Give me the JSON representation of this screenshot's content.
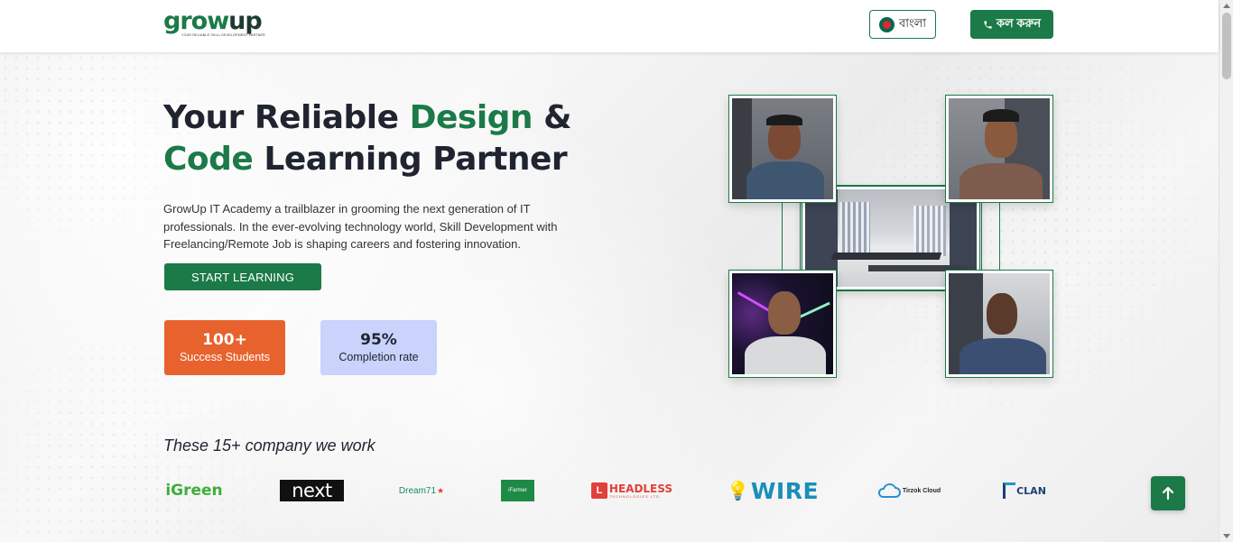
{
  "header": {
    "logo_grow": "grow",
    "logo_up": "up",
    "logo_tagline": "YOUR RELIABLE SKILL DEVELOPMENT PARTNER",
    "language_label": "বাংলা",
    "call_label": "কল করুন",
    "call_icon": "phone-icon",
    "flag_icon": "bangladesh-flag-icon"
  },
  "hero": {
    "title_part1": "Your Reliable ",
    "title_hl1": "Design",
    "title_part2": " &",
    "title_hl2": "Code",
    "title_part3": " Learning Partner",
    "description": "GrowUp IT Academy a trailblazer in grooming the next generation of IT professionals. In the ever-evolving technology world, Skill Development with Freelancing/Remote Job is shaping careers and fostering innovation.",
    "cta_label": "START LEARNING"
  },
  "stats": [
    {
      "value": "100+",
      "label": "Success Students"
    },
    {
      "value": "95%",
      "label": "Completion rate"
    }
  ],
  "companies": {
    "title": "These 15+ company we work",
    "logos": [
      {
        "name": "Green",
        "text": "iGreen"
      },
      {
        "name": "next",
        "text": "next"
      },
      {
        "name": "Dream71",
        "text": "Dream71"
      },
      {
        "name": "iFarmer",
        "text": "iFarmer"
      },
      {
        "name": "Headless",
        "text": "HEADLESS",
        "sub": "TECHNOLOGIES LTD"
      },
      {
        "name": "Wire",
        "text": "WIRE"
      },
      {
        "name": "Tirzok Cloud",
        "text": "Tirzok Cloud"
      },
      {
        "name": "Clan",
        "text": "CLAN"
      }
    ]
  },
  "colors": {
    "brand_green": "#1b7a47",
    "orange": "#e8622e",
    "lavender": "#c9d3fb"
  },
  "icons": {
    "scroll_top": "arrow-up-icon"
  }
}
